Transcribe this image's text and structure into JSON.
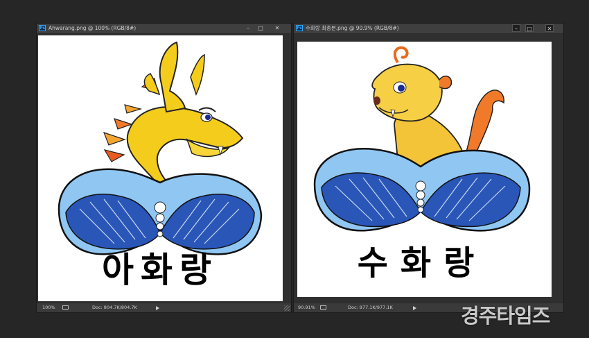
{
  "app": "Photoshop",
  "windows": [
    {
      "app_icon": "Ps",
      "title": "Ahwarang.png @ 100% (RGB/8#)",
      "controls": [
        "–",
        "□",
        "✕"
      ],
      "status": {
        "zoom": "100%",
        "doc": "Doc: 804.7K/804.7K"
      },
      "artwork": {
        "subject": "dragon-mascot",
        "caption": "아화랑"
      }
    },
    {
      "app_icon": "Ps",
      "title": "수화랑 최종본.png @ 90.9% (RGB/8#)",
      "controls": [
        "–",
        "□",
        "✕"
      ],
      "status": {
        "zoom": "90.91%",
        "doc": "Doc: 977.1K/977.1K"
      },
      "artwork": {
        "subject": "lion-mascot",
        "caption": "수화랑"
      }
    }
  ],
  "watermark": "경주타임즈",
  "colors": {
    "workspace": "#262626",
    "panel": "#3c3c3c",
    "shell_dark": "#2a56b8",
    "shell_light": "#8fc6f2",
    "dragon_yellow": "#f4cc1c",
    "lion_yellow": "#f3c437",
    "flame_orange": "#f07a2a"
  }
}
